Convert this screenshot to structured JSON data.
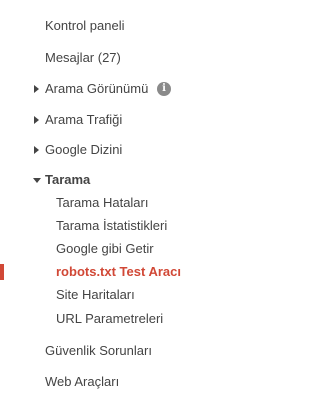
{
  "nav": {
    "items": [
      {
        "label": "Kontrol paneli"
      },
      {
        "label": "Mesajlar (27)"
      },
      {
        "label": "Arama Görünümü"
      },
      {
        "label": "Arama Trafiği"
      },
      {
        "label": "Google Dizini"
      },
      {
        "label": "Tarama"
      },
      {
        "label": "Güvenlik Sorunları"
      },
      {
        "label": "Web Araçları"
      }
    ],
    "info_icon_glyph": "i",
    "tarama_children": [
      {
        "label": "Tarama Hataları"
      },
      {
        "label": "Tarama İstatistikleri"
      },
      {
        "label": "Google gibi Getir"
      },
      {
        "label": "robots.txt Test Aracı"
      },
      {
        "label": "Site Haritaları"
      },
      {
        "label": "URL Parametreleri"
      }
    ]
  },
  "colors": {
    "text": "#444444",
    "active": "#d14836",
    "info_icon": "#8a8a8a"
  },
  "icons": {
    "collapsed": "triangle-right-icon",
    "expanded": "triangle-down-icon",
    "info": "info-icon"
  }
}
